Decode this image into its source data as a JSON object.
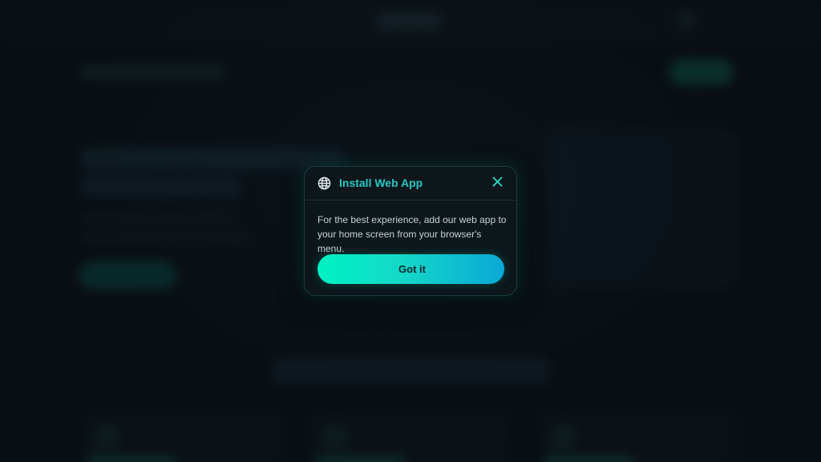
{
  "modal": {
    "title_glyph": "",
    "title": "Install Web App",
    "body": "For the best experience, add our web app to your home screen from your browser's menu.",
    "button_glyph": "",
    "button_label": "Got it",
    "icons": {
      "header": "globe-icon",
      "close": "close-icon"
    }
  },
  "colors": {
    "accent": "#27c6c0",
    "button_gradient_start": "#00f2c3",
    "button_gradient_end": "#0aa8d6",
    "background": "#0b1116"
  }
}
